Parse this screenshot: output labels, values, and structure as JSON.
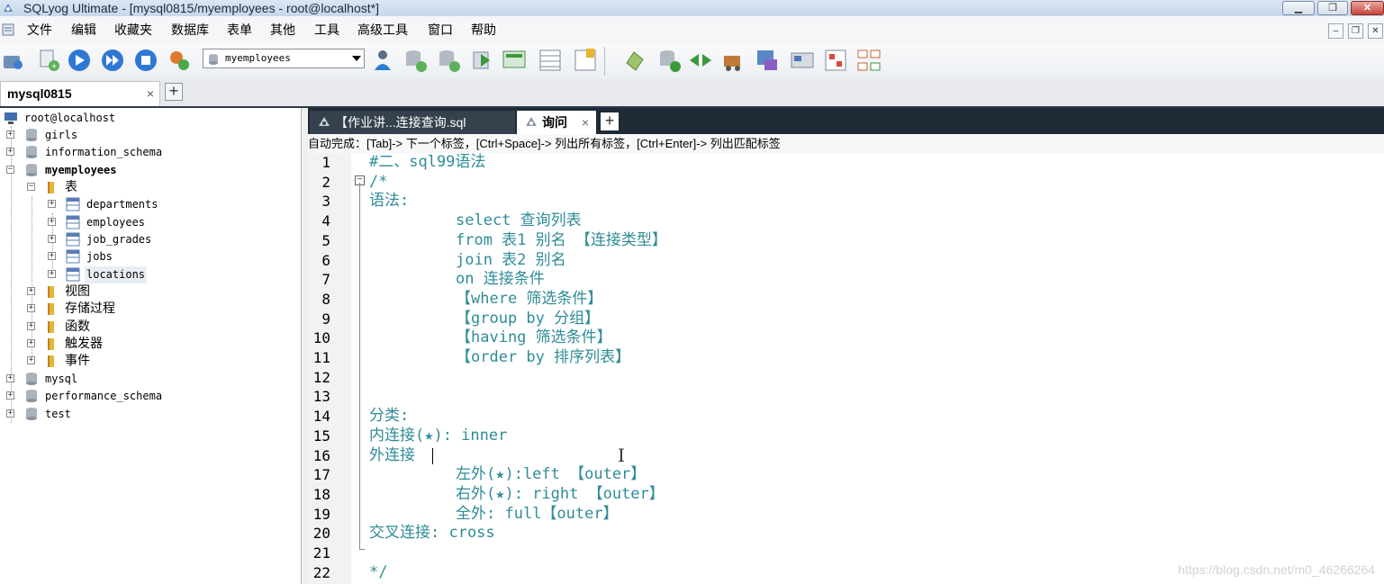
{
  "window": {
    "title": "SQLyog Ultimate - [mysql0815/myemployees - root@localhost*]"
  },
  "menu": [
    "文件",
    "编辑",
    "收藏夹",
    "数据库",
    "表单",
    "其他",
    "工具",
    "高级工具",
    "窗口",
    "帮助"
  ],
  "toolbar": {
    "database_select": "myemployees"
  },
  "connection_tab": {
    "label": "mysql0815",
    "close": "×",
    "add": "+"
  },
  "tree": {
    "root": "root@localhost",
    "databases": [
      "girls",
      "information_schema",
      "myemployees",
      "mysql",
      "performance_schema",
      "test"
    ],
    "myemployees": {
      "tables_folder": "表",
      "tables": [
        "departments",
        "employees",
        "job_grades",
        "jobs",
        "locations"
      ],
      "folders": [
        "视图",
        "存储过程",
        "函数",
        "触发器",
        "事件"
      ]
    },
    "expand_plus": "+",
    "expand_minus": "−"
  },
  "query_tabs": [
    {
      "label": "【作业讲...连接查询.sql",
      "active": false
    },
    {
      "label": "询问",
      "active": true,
      "close": "×"
    }
  ],
  "query_add": "+",
  "autocomplete_hint": "自动完成：[Tab]-> 下一个标签，[Ctrl+Space]-> 列出所有标签，[Ctrl+Enter]-> 列出匹配标签",
  "editor": {
    "lines": [
      "#二、sql99语法",
      "/*",
      "语法:",
      "\tselect 查询列表",
      "\tfrom 表1 别名 【连接类型】",
      "\tjoin 表2 别名",
      "\ton 连接条件",
      "\t【where 筛选条件】",
      "\t【group by 分组】",
      "\t【having 筛选条件】",
      "\t【order by 排序列表】",
      "",
      "",
      "分类:",
      "内连接(★): inner",
      "外连接",
      "\t左外(★):left 【outer】",
      "\t右外(★): right 【outer】",
      "\t全外: full【outer】",
      "交叉连接: cross",
      "",
      "*/"
    ],
    "fold_marker": "−",
    "cursor_glyph": "I"
  },
  "watermark": "https://blog.csdn.net/m0_46266264",
  "colors": {
    "code": "#2f8c97",
    "dark_tabbar": "#1f2a36"
  }
}
